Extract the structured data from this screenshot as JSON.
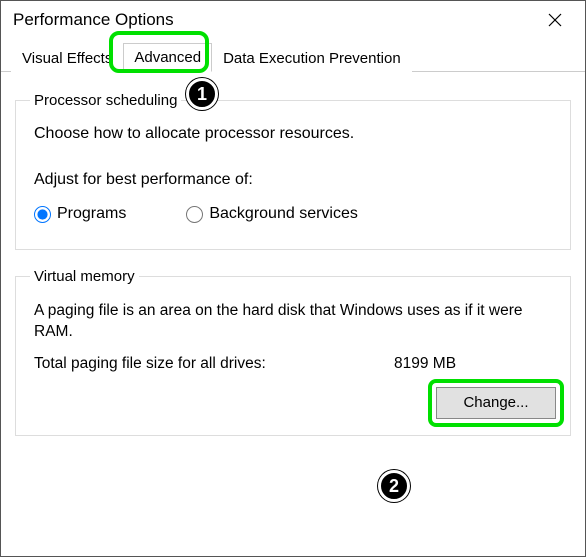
{
  "window": {
    "title": "Performance Options"
  },
  "tabs": {
    "visual_effects": "Visual Effects",
    "advanced": "Advanced",
    "dep": "Data Execution Prevention"
  },
  "processor": {
    "legend": "Processor scheduling",
    "description": "Choose how to allocate processor resources.",
    "subheading": "Adjust for best performance of:",
    "programs_label": "Programs",
    "background_label": "Background services"
  },
  "vm": {
    "legend": "Virtual memory",
    "description": "A paging file is an area on the hard disk that Windows uses as if it were RAM.",
    "total_label": "Total paging file size for all drives:",
    "total_value": "8199 MB",
    "change_label": "Change..."
  },
  "callouts": {
    "one": "1",
    "two": "2"
  }
}
